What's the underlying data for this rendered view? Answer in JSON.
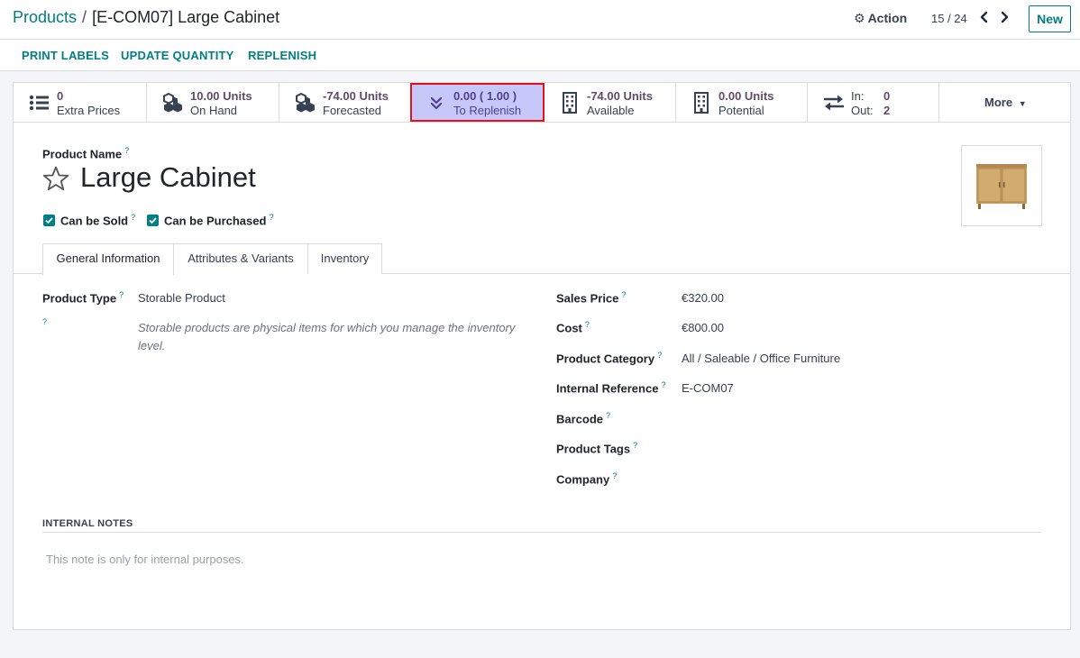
{
  "breadcrumb": {
    "parent": "Products",
    "separator": "/",
    "current": "[E-COM07] Large Cabinet"
  },
  "header": {
    "action_label": "Action",
    "pager": "15 / 24",
    "new_label": "New"
  },
  "actionbar": {
    "buttons": [
      "PRINT LABELS",
      "UPDATE QUANTITY",
      "REPLENISH"
    ]
  },
  "smart_buttons": [
    {
      "value": "0",
      "label": "Extra Prices",
      "icon": "list-icon"
    },
    {
      "value": "10.00 Units",
      "label": "On Hand",
      "icon": "cubes-icon"
    },
    {
      "value": "-74.00 Units",
      "label": "Forecasted",
      "icon": "cubes-icon"
    },
    {
      "value": "0.00 ( 1.00 )",
      "label": "To Replenish",
      "icon": "double-chevron-down-icon"
    },
    {
      "value": "-74.00 Units",
      "label": "Available",
      "icon": "building-icon"
    },
    {
      "value": "0.00 Units",
      "label": "Potential",
      "icon": "building-icon"
    }
  ],
  "in_out": {
    "in_label": "In:",
    "in_value": "0",
    "out_label": "Out:",
    "out_value": "2"
  },
  "more_label": "More",
  "product": {
    "name_label": "Product Name",
    "name": "Large Cabinet",
    "can_be_sold_label": "Can be Sold",
    "can_be_purchased_label": "Can be Purchased",
    "can_be_sold": true,
    "can_be_purchased": true
  },
  "tabs": [
    "General Information",
    "Attributes & Variants",
    "Inventory"
  ],
  "general": {
    "product_type_label": "Product Type",
    "product_type": "Storable Product",
    "product_type_help": "Storable products are physical items for which you manage the inventory level.",
    "sales_price_label": "Sales Price",
    "sales_price": "€320.00",
    "cost_label": "Cost",
    "cost": "€800.00",
    "category_label": "Product Category",
    "category": "All / Saleable / Office Furniture",
    "internal_ref_label": "Internal Reference",
    "internal_ref": "E-COM07",
    "barcode_label": "Barcode",
    "tags_label": "Product Tags",
    "company_label": "Company"
  },
  "notes": {
    "title": "INTERNAL NOTES",
    "placeholder": "This note is only for internal purposes."
  },
  "help_mark": "?",
  "colors": {
    "accent": "#017e84",
    "highlight_bg": "#c7c8fa",
    "highlight_border": "#e0121d"
  }
}
